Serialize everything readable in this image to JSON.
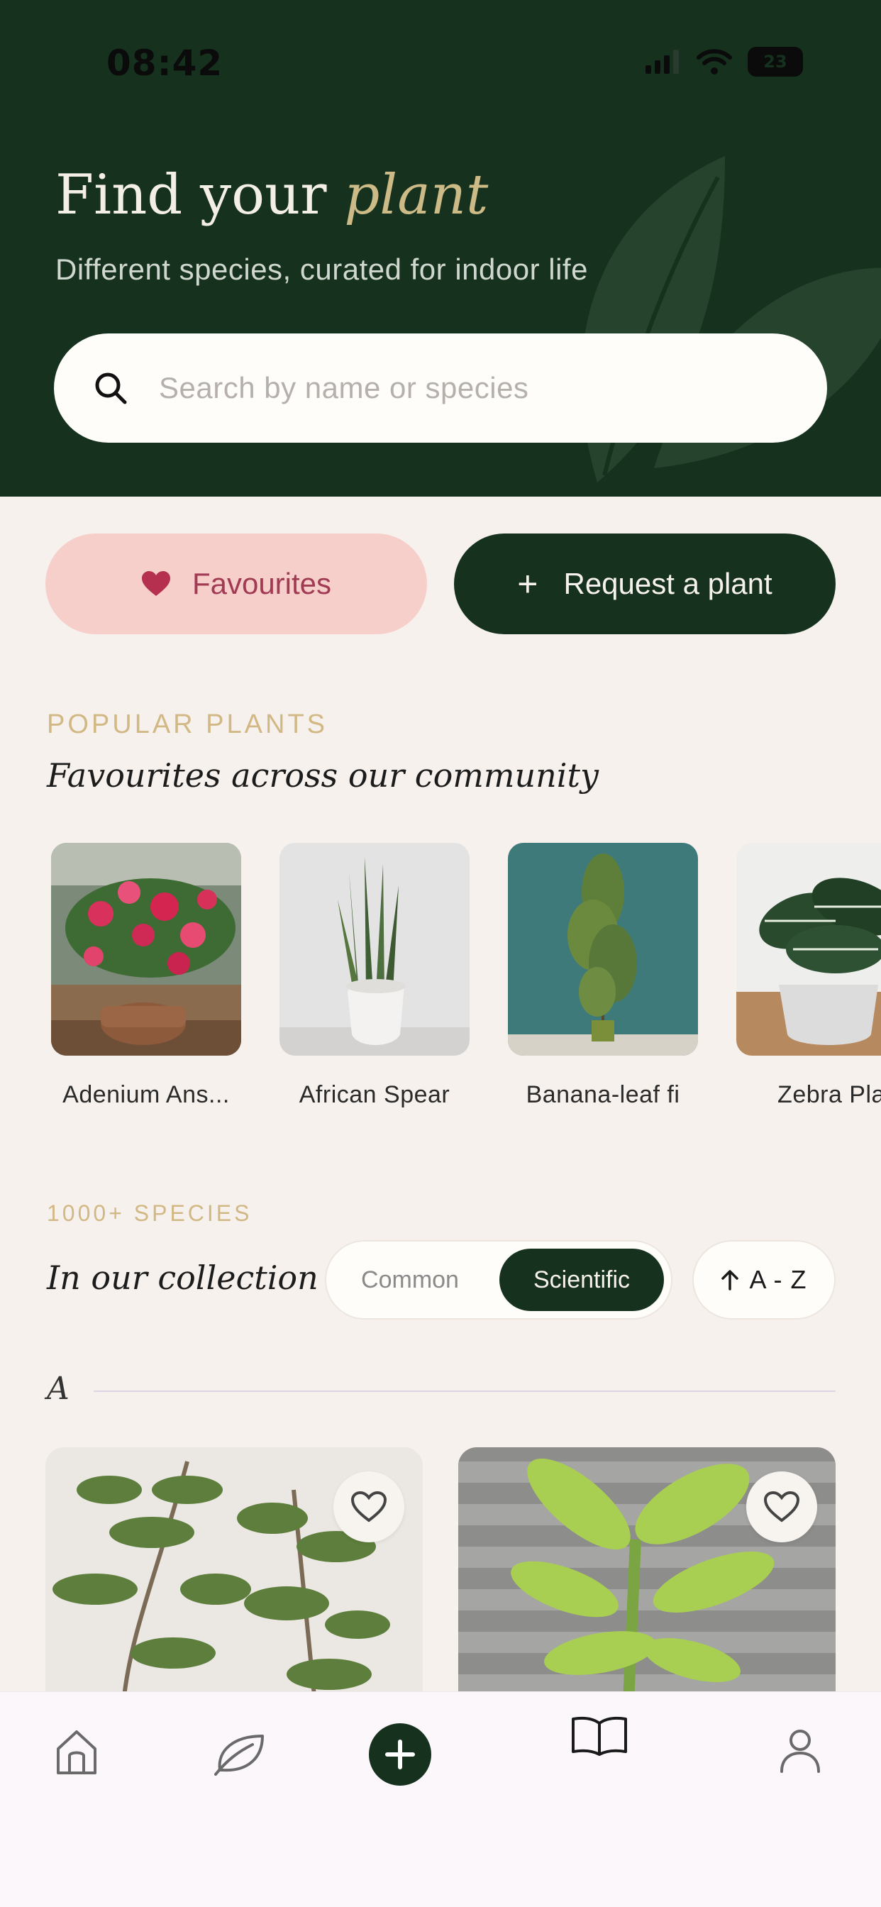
{
  "status_bar": {
    "time": "08:42",
    "battery": "23"
  },
  "header": {
    "title_main": "Find your",
    "title_accent": "plant",
    "subtitle": "Different species, curated for indoor life"
  },
  "search": {
    "placeholder": "Search by name or species"
  },
  "actions": {
    "favourites_label": "Favourites",
    "request_label": "Request a plant"
  },
  "popular": {
    "eyebrow": "POPULAR PLANTS",
    "title": "Favourites across our community",
    "plants": [
      {
        "name": "Adenium Ans..."
      },
      {
        "name": "African Spear"
      },
      {
        "name": "Banana-leaf fi"
      },
      {
        "name": "Zebra Pla"
      }
    ]
  },
  "collection": {
    "eyebrow": "1000+ SPECIES",
    "title": "In our collection",
    "toggle": {
      "common": "Common",
      "scientific": "Scientific",
      "selected": "Scientific"
    },
    "sort_label": "A - Z",
    "letter": "A"
  },
  "tabbar": {
    "items": [
      "home-icon",
      "leaf-icon",
      "add-icon",
      "book-icon",
      "profile-icon"
    ]
  },
  "colors": {
    "header_bg": "#16321e",
    "page_bg": "#f6f1ec",
    "accent_gold": "#cdbb87",
    "favourite_pink": "#f6cfcb",
    "favourite_text": "#a13a52"
  }
}
